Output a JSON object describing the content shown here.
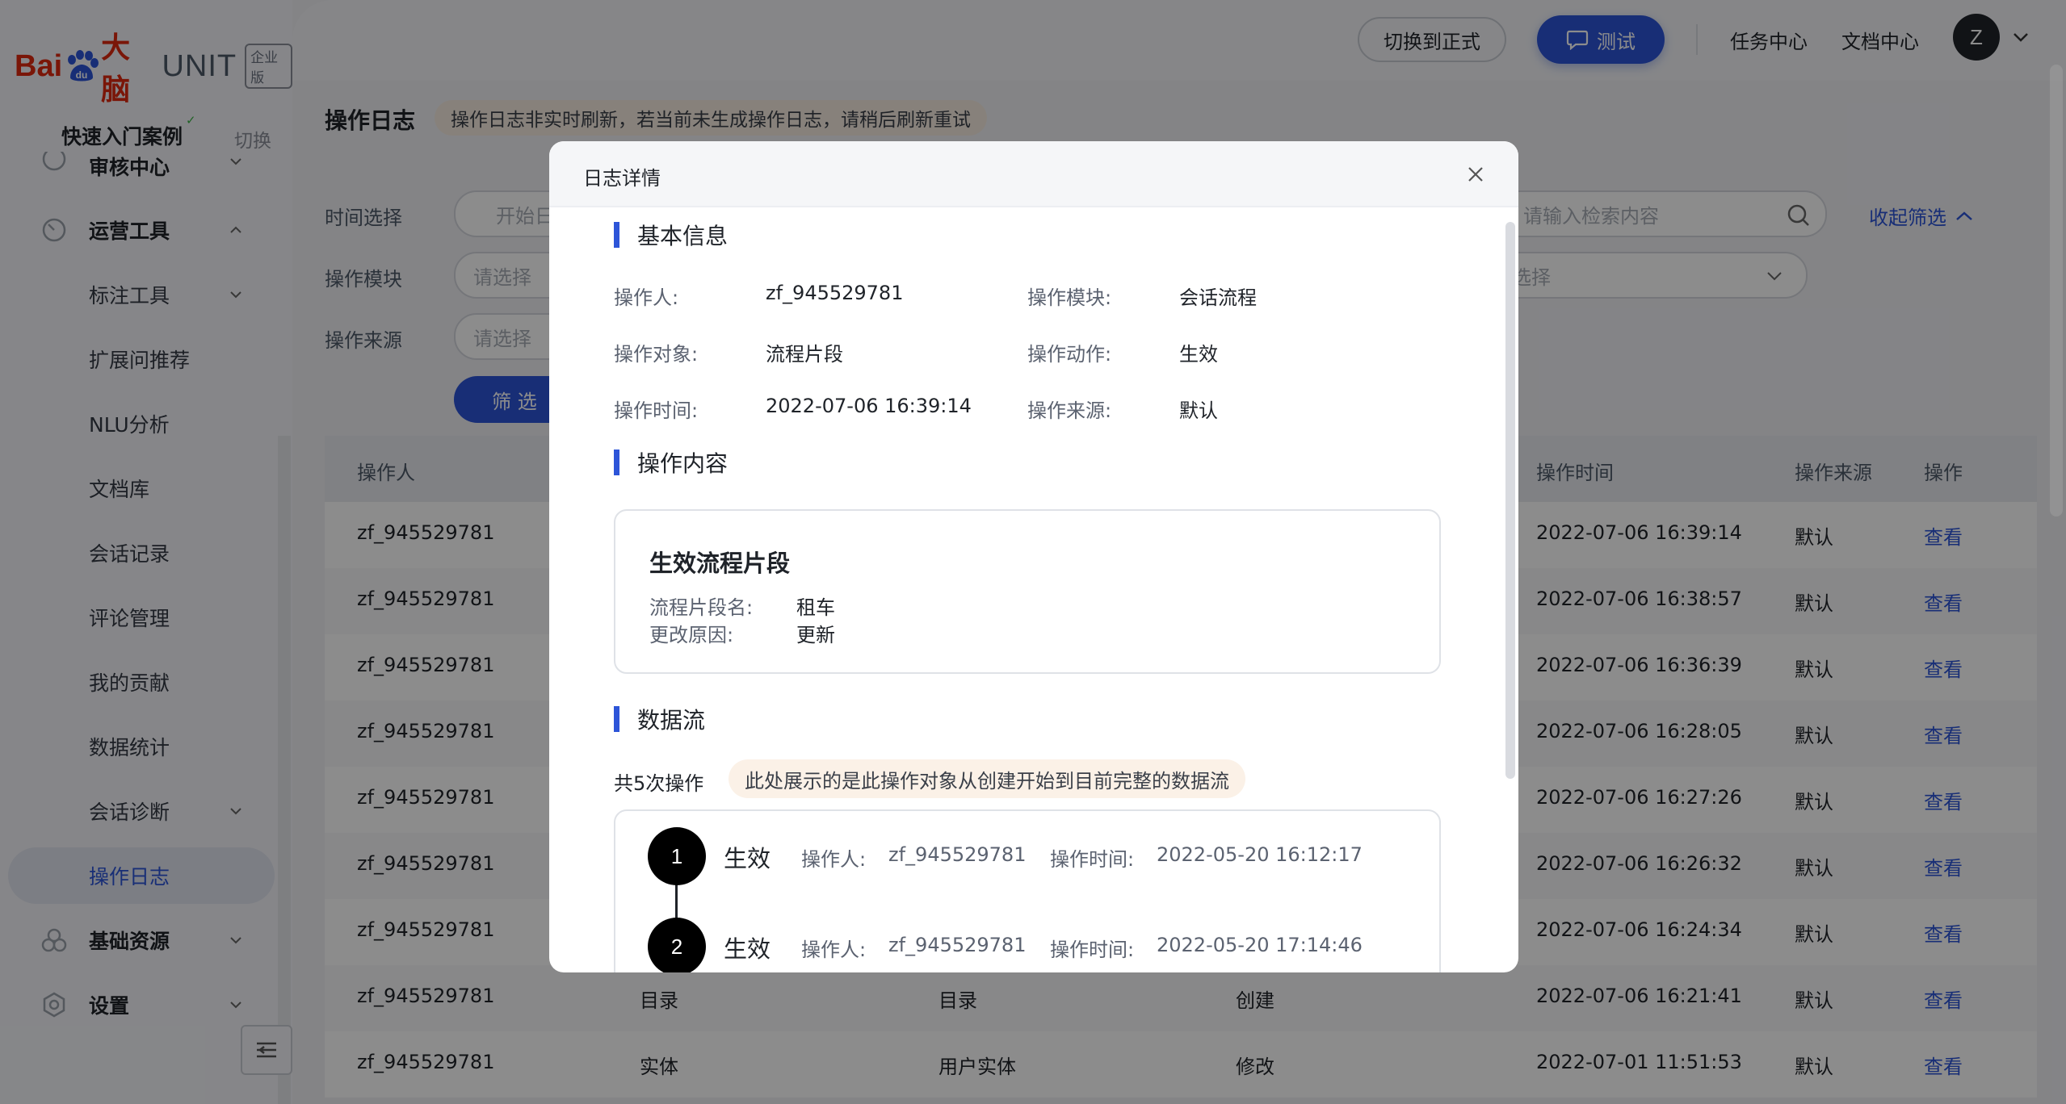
{
  "logo": {
    "bai": "Bai",
    "du": "du",
    "brand_cn": "大脑",
    "product": "UNIT",
    "edition": "企业版"
  },
  "sidebar": {
    "quick_entry": "快速入门案例",
    "switch_label": "切换",
    "items": [
      {
        "label": "审核中心",
        "type": "group"
      },
      {
        "label": "运营工具",
        "type": "group"
      },
      {
        "label": "标注工具",
        "type": "sub"
      },
      {
        "label": "扩展问推荐",
        "type": "sub"
      },
      {
        "label": "NLU分析",
        "type": "sub"
      },
      {
        "label": "文档库",
        "type": "sub"
      },
      {
        "label": "会话记录",
        "type": "sub"
      },
      {
        "label": "评论管理",
        "type": "sub"
      },
      {
        "label": "我的贡献",
        "type": "sub"
      },
      {
        "label": "数据统计",
        "type": "sub"
      },
      {
        "label": "会话诊断",
        "type": "sub"
      },
      {
        "label": "操作日志",
        "type": "sub",
        "active": true
      },
      {
        "label": "基础资源",
        "type": "group"
      },
      {
        "label": "设置",
        "type": "group"
      }
    ]
  },
  "topbar": {
    "switch_formal": "切换到正式",
    "test": "测试",
    "task_center": "任务中心",
    "doc_center": "文档中心",
    "avatar_letter": "Z"
  },
  "page": {
    "title": "操作日志",
    "tip": "操作日志非实时刷新，若当前未生成操作日志，请稍后刷新重试",
    "filters": {
      "time_label": "时间选择",
      "time_placeholder": "开始日",
      "module_label": "操作模块",
      "module_placeholder": "请选择",
      "source_label": "操作来源",
      "source_placeholder": "请选择",
      "search_placeholder": "请输入检索内容",
      "select_placeholder": "选择",
      "filter_button": "筛 选",
      "collapse": "收起筛选"
    }
  },
  "table": {
    "headers": {
      "operator": "操作人",
      "time": "操作时间",
      "source": "操作来源",
      "action": "操作"
    },
    "rows": [
      {
        "operator": "zf_945529781",
        "module": "",
        "object": "",
        "act": "",
        "time": "2022-07-06 16:39:14",
        "source": "默认",
        "view": "查看"
      },
      {
        "operator": "zf_945529781",
        "module": "",
        "object": "",
        "act": "",
        "time": "2022-07-06 16:38:57",
        "source": "默认",
        "view": "查看"
      },
      {
        "operator": "zf_945529781",
        "module": "",
        "object": "",
        "act": "",
        "time": "2022-07-06 16:36:39",
        "source": "默认",
        "view": "查看"
      },
      {
        "operator": "zf_945529781",
        "module": "",
        "object": "",
        "act": "",
        "time": "2022-07-06 16:28:05",
        "source": "默认",
        "view": "查看"
      },
      {
        "operator": "zf_945529781",
        "module": "",
        "object": "",
        "act": "",
        "time": "2022-07-06 16:27:26",
        "source": "默认",
        "view": "查看"
      },
      {
        "operator": "zf_945529781",
        "module": "",
        "object": "",
        "act": "",
        "time": "2022-07-06 16:26:32",
        "source": "默认",
        "view": "查看"
      },
      {
        "operator": "zf_945529781",
        "module": "",
        "object": "",
        "act": "",
        "time": "2022-07-06 16:24:34",
        "source": "默认",
        "view": "查看"
      },
      {
        "operator": "zf_945529781",
        "module": "目录",
        "object": "目录",
        "act": "创建",
        "time": "2022-07-06 16:21:41",
        "source": "默认",
        "view": "查看"
      },
      {
        "operator": "zf_945529781",
        "module": "实体",
        "object": "用户实体",
        "act": "修改",
        "time": "2022-07-01 11:51:53",
        "source": "默认",
        "view": "查看"
      }
    ]
  },
  "modal": {
    "title": "日志详情",
    "basic_title": "基本信息",
    "basic": {
      "operator_label": "操作人:",
      "operator": "zf_945529781",
      "module_label": "操作模块:",
      "module": "会话流程",
      "object_label": "操作对象:",
      "object": "流程片段",
      "action_label": "操作动作:",
      "action": "生效",
      "time_label": "操作时间:",
      "time": "2022-07-06 16:39:14",
      "source_label": "操作来源:",
      "source": "默认"
    },
    "content_title": "操作内容",
    "content": {
      "heading": "生效流程片段",
      "name_label": "流程片段名:",
      "name": "租车",
      "reason_label": "更改原因:",
      "reason": "更新"
    },
    "flow_title": "数据流",
    "flow_count": "共5次操作",
    "flow_tip": "此处展示的是此操作对象从创建开始到目前完整的数据流",
    "flow": [
      {
        "num": "1",
        "action": "生效",
        "operator_label": "操作人:",
        "operator": "zf_945529781",
        "time_label": "操作时间:",
        "time": "2022-05-20 16:12:17"
      },
      {
        "num": "2",
        "action": "生效",
        "operator_label": "操作人:",
        "operator": "zf_945529781",
        "time_label": "操作时间:",
        "time": "2022-05-20 17:14:46"
      }
    ]
  },
  "colors": {
    "accent": "#2d55d8",
    "brand_red": "#de2910",
    "tip_bg": "#f6ece1"
  }
}
